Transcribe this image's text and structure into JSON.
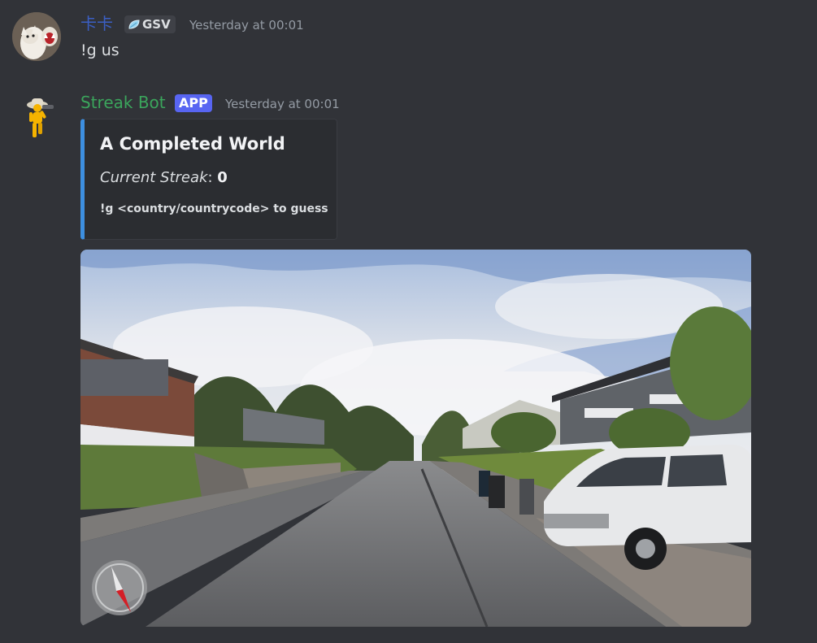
{
  "messages": [
    {
      "author": "卡卡",
      "author_color": "#3b5fc4",
      "clan_tag": "GSV",
      "timestamp": "Yesterday at 00:01",
      "content": "!g us"
    },
    {
      "author": "Streak Bot",
      "author_color": "#3ba55c",
      "app_badge": "APP",
      "timestamp": "Yesterday at 00:01",
      "embed": {
        "title": "A Completed World",
        "streak_label": "Current Streak",
        "streak_sep": ": ",
        "streak_value": "0",
        "footer": "!g <country/countrycode> to guess",
        "accent_color": "#3d8fe0"
      },
      "image": {
        "alt_icon": "street-view-photo",
        "compass_icon": "compass-icon"
      }
    }
  ],
  "colors": {
    "background": "#313338",
    "app_badge_bg": "#5865f2",
    "clan_tag_bg": "#3f4147"
  }
}
